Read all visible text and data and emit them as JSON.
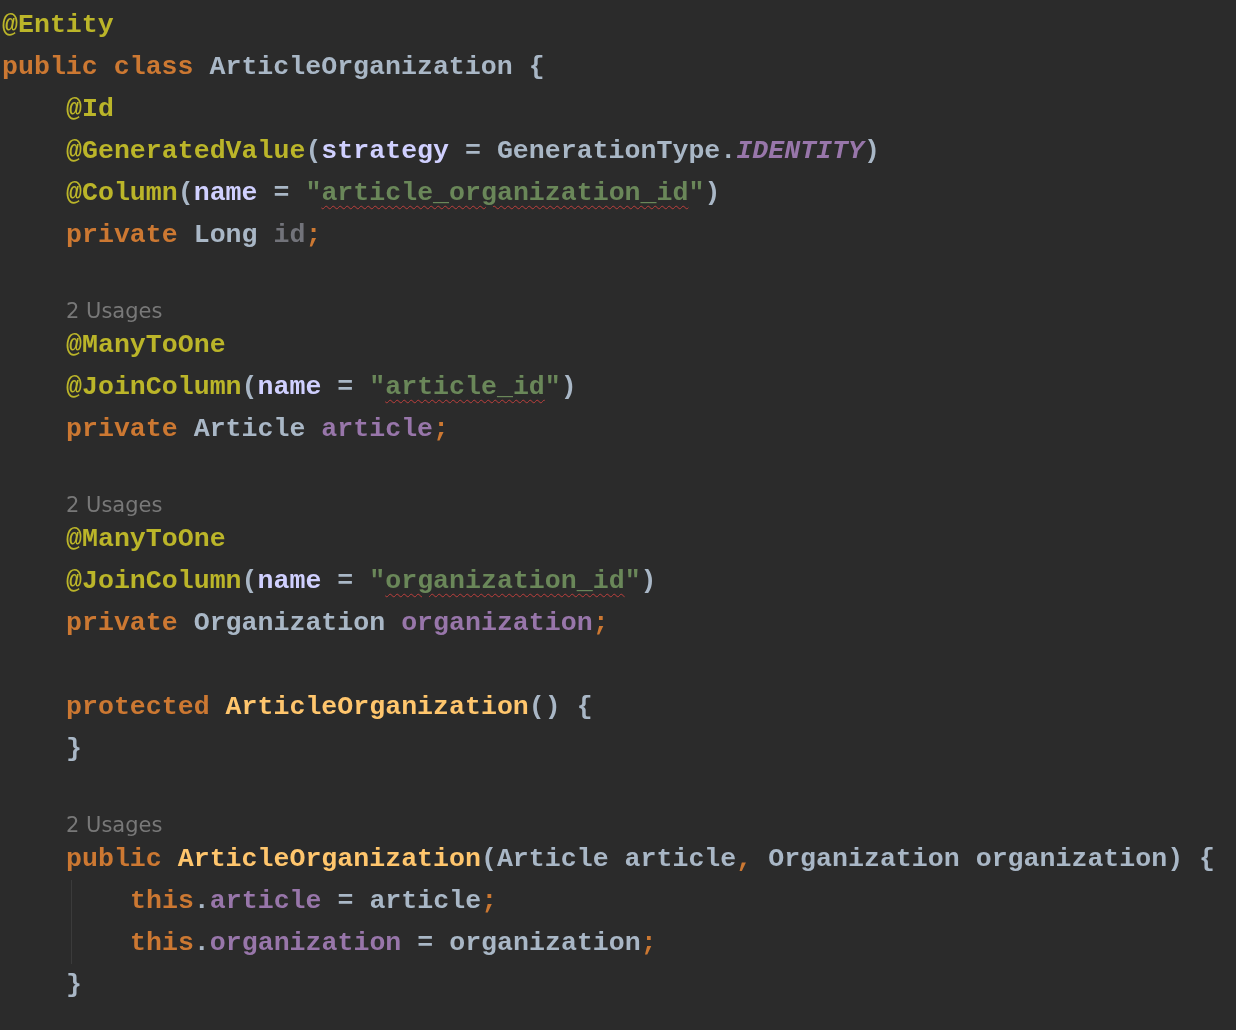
{
  "editor": {
    "lines": [
      {
        "kind": "code",
        "tokens": [
          {
            "text": "@Entity",
            "kind": "annotation"
          }
        ]
      },
      {
        "kind": "code",
        "tokens": [
          {
            "text": "public class ",
            "kind": "keyword"
          },
          {
            "text": "ArticleOrganization {",
            "kind": "plain"
          }
        ],
        "children": [
          {
            "kind": "code",
            "tokens": [
              {
                "text": "@Id",
                "kind": "annotation"
              }
            ]
          },
          {
            "kind": "code",
            "tokens": [
              {
                "text": "@GeneratedValue",
                "kind": "annotation"
              },
              {
                "text": "(",
                "kind": "plain"
              },
              {
                "text": "strategy",
                "kind": "param"
              },
              {
                "text": " = GenerationType.",
                "kind": "plain"
              },
              {
                "text": "IDENTITY",
                "kind": "static"
              },
              {
                "text": ")",
                "kind": "plain"
              }
            ]
          },
          {
            "kind": "code",
            "tokens": [
              {
                "text": "@Column",
                "kind": "annotation"
              },
              {
                "text": "(",
                "kind": "plain"
              },
              {
                "text": "name",
                "kind": "param"
              },
              {
                "text": " = ",
                "kind": "plain"
              },
              {
                "text": "\"",
                "kind": "string"
              },
              {
                "text": "article_organization_id",
                "kind": "string",
                "typo": true
              },
              {
                "text": "\"",
                "kind": "string"
              },
              {
                "text": ")",
                "kind": "plain"
              }
            ]
          },
          {
            "kind": "code",
            "tokens": [
              {
                "text": "private ",
                "kind": "keyword"
              },
              {
                "text": "Long ",
                "kind": "plain"
              },
              {
                "text": "id",
                "kind": "unused"
              },
              {
                "text": ";",
                "kind": "punct"
              }
            ]
          },
          {
            "kind": "blank"
          },
          {
            "kind": "hint",
            "text": "2 Usages"
          },
          {
            "kind": "code",
            "tokens": [
              {
                "text": "@ManyToOne",
                "kind": "annotation"
              }
            ]
          },
          {
            "kind": "code",
            "tokens": [
              {
                "text": "@JoinColumn",
                "kind": "annotation"
              },
              {
                "text": "(",
                "kind": "plain"
              },
              {
                "text": "name",
                "kind": "param"
              },
              {
                "text": " = ",
                "kind": "plain"
              },
              {
                "text": "\"",
                "kind": "string"
              },
              {
                "text": "article_id",
                "kind": "string",
                "typo": true
              },
              {
                "text": "\"",
                "kind": "string"
              },
              {
                "text": ")",
                "kind": "plain"
              }
            ]
          },
          {
            "kind": "code",
            "tokens": [
              {
                "text": "private ",
                "kind": "keyword"
              },
              {
                "text": "Article ",
                "kind": "plain"
              },
              {
                "text": "article",
                "kind": "field"
              },
              {
                "text": ";",
                "kind": "punct"
              }
            ]
          },
          {
            "kind": "blank"
          },
          {
            "kind": "hint",
            "text": "2 Usages"
          },
          {
            "kind": "code",
            "tokens": [
              {
                "text": "@ManyToOne",
                "kind": "annotation"
              }
            ]
          },
          {
            "kind": "code",
            "tokens": [
              {
                "text": "@JoinColumn",
                "kind": "annotation"
              },
              {
                "text": "(",
                "kind": "plain"
              },
              {
                "text": "name",
                "kind": "param"
              },
              {
                "text": " = ",
                "kind": "plain"
              },
              {
                "text": "\"",
                "kind": "string"
              },
              {
                "text": "organization_id",
                "kind": "string",
                "typo": true
              },
              {
                "text": "\"",
                "kind": "string"
              },
              {
                "text": ")",
                "kind": "plain"
              }
            ]
          },
          {
            "kind": "code",
            "tokens": [
              {
                "text": "private ",
                "kind": "keyword"
              },
              {
                "text": "Organization ",
                "kind": "plain"
              },
              {
                "text": "organization",
                "kind": "field"
              },
              {
                "text": ";",
                "kind": "punct"
              }
            ]
          },
          {
            "kind": "blank"
          },
          {
            "kind": "code",
            "tokens": [
              {
                "text": "protected ",
                "kind": "keyword"
              },
              {
                "text": "ArticleOrganization",
                "kind": "method"
              },
              {
                "text": "() {",
                "kind": "plain"
              }
            ]
          },
          {
            "kind": "code",
            "tokens": [
              {
                "text": "}",
                "kind": "plain"
              }
            ]
          },
          {
            "kind": "blank"
          },
          {
            "kind": "hint",
            "text": "2 Usages"
          },
          {
            "kind": "code",
            "tokens": [
              {
                "text": "public ",
                "kind": "keyword"
              },
              {
                "text": "ArticleOrganization",
                "kind": "method"
              },
              {
                "text": "(Article article",
                "kind": "plain"
              },
              {
                "text": ", ",
                "kind": "punct"
              },
              {
                "text": "Organization organization) {",
                "kind": "plain"
              }
            ],
            "indent_guide": true,
            "children": [
              {
                "kind": "code",
                "tokens": [
                  {
                    "text": "this",
                    "kind": "keyword"
                  },
                  {
                    "text": ".",
                    "kind": "plain"
                  },
                  {
                    "text": "article",
                    "kind": "field"
                  },
                  {
                    "text": " = article",
                    "kind": "plain"
                  },
                  {
                    "text": ";",
                    "kind": "punct"
                  }
                ]
              },
              {
                "kind": "code",
                "tokens": [
                  {
                    "text": "this",
                    "kind": "keyword"
                  },
                  {
                    "text": ".",
                    "kind": "plain"
                  },
                  {
                    "text": "organization",
                    "kind": "field"
                  },
                  {
                    "text": " = organization",
                    "kind": "plain"
                  },
                  {
                    "text": ";",
                    "kind": "punct"
                  }
                ]
              }
            ]
          },
          {
            "kind": "code",
            "tokens": [
              {
                "text": "}",
                "kind": "plain"
              }
            ]
          }
        ]
      }
    ]
  }
}
